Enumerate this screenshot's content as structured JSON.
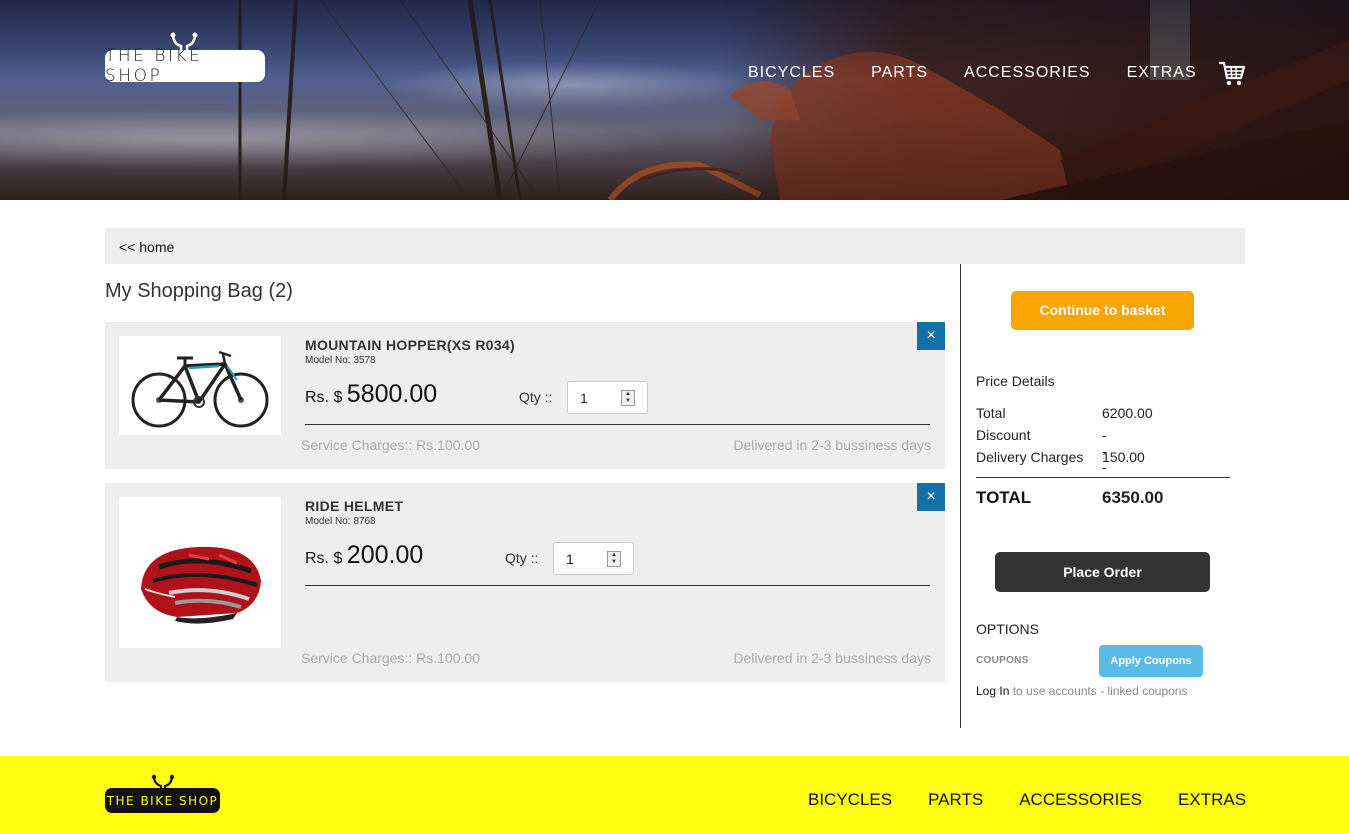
{
  "brand": {
    "logo_text": "THE BIKE SHOP"
  },
  "nav": {
    "items": [
      "BICYCLES",
      "PARTS",
      "ACCESSORIES",
      "EXTRAS"
    ]
  },
  "breadcrumb": {
    "home_link": "<< home"
  },
  "bag": {
    "title": "My Shopping Bag (2)",
    "items": [
      {
        "name": "MOUNTAIN HOPPER(XS R034)",
        "model": "Model No: 3578",
        "currency": "Rs. $",
        "price": "5800.00",
        "qty_label": "Qty ::",
        "qty": "1",
        "service": "Service Charges:: Rs.100.00",
        "delivery": "Delivered in 2-3 bussiness days",
        "close": "×"
      },
      {
        "name": "RIDE HELMET",
        "model": "Model No: 8768",
        "currency": "Rs. $",
        "price": "200.00",
        "qty_label": "Qty ::",
        "qty": "1",
        "service": "Service Charges:: Rs.100.00",
        "delivery": "Delivered in 2-3 bussiness days",
        "close": "×"
      }
    ]
  },
  "summary": {
    "continue_label": "Continue to basket",
    "price_details_title": "Price Details",
    "rows": [
      {
        "label": "Total",
        "value": "6200.00"
      },
      {
        "label": "Discount",
        "value": "---"
      },
      {
        "label": "Delivery Charges",
        "value": "150.00"
      }
    ],
    "grand_total_label": "TOTAL",
    "grand_total_value": "6350.00",
    "place_order_label": "Place Order",
    "options_title": "OPTIONS",
    "coupons_label": "COUPONS",
    "apply_coupons_label": "Apply Coupons",
    "login_link": "Log In",
    "login_rest": " to use accounts - linked coupons"
  },
  "footer": {
    "logo_text": "THE BIKE SHOP",
    "nav": [
      "BICYCLES",
      "PARTS",
      "ACCESSORIES",
      "EXTRAS"
    ]
  },
  "colors": {
    "accent_orange": "#f9a602",
    "close_blue": "#1470a6",
    "coupon_blue": "#5bbbe5",
    "footer_yellow": "#ffff0f",
    "dark_button": "#333333"
  }
}
